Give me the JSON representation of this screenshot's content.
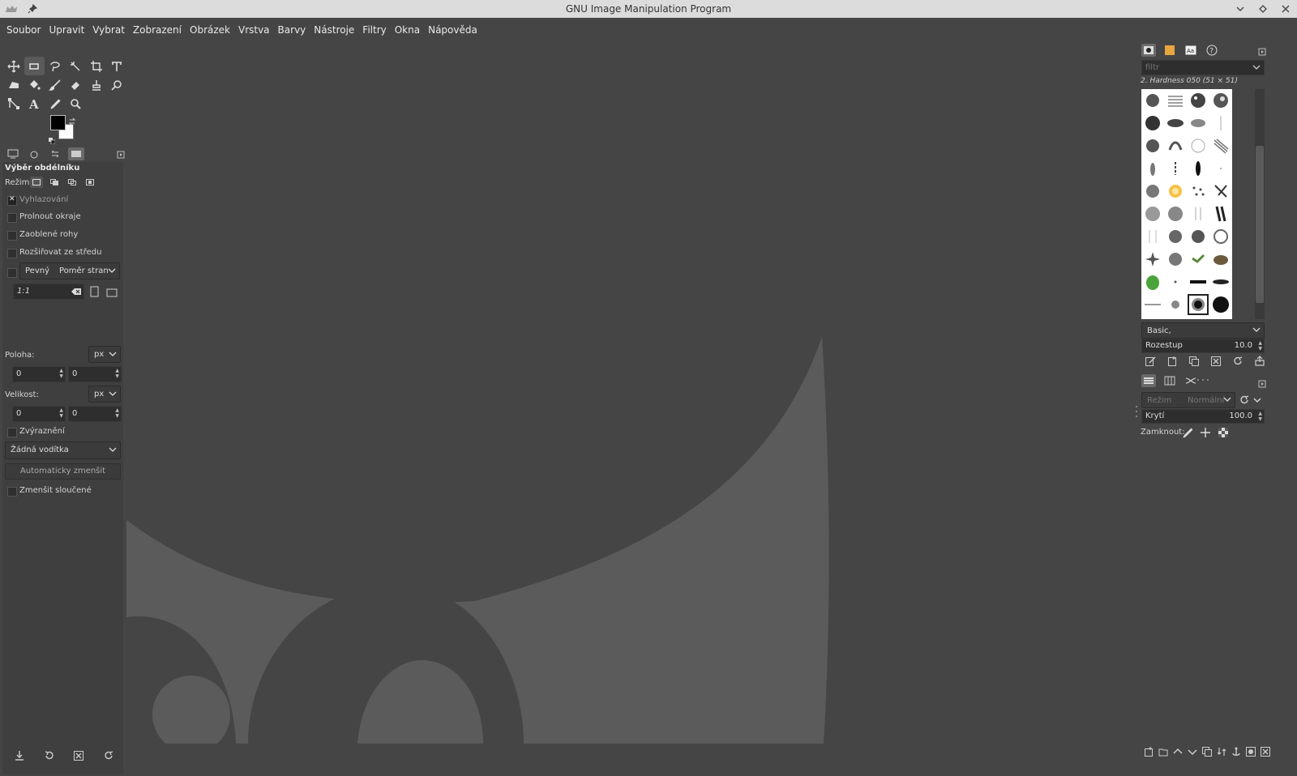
{
  "window": {
    "title": "GNU Image Manipulation Program"
  },
  "menu": [
    "Soubor",
    "Upravit",
    "Vybrat",
    "Zobrazení",
    "Obrázek",
    "Vrstva",
    "Barvy",
    "Nástroje",
    "Filtry",
    "Okna",
    "Nápověda"
  ],
  "tool_options": {
    "title": "Výběr obdélníku",
    "mode_label": "Režim:",
    "antialiasing": "Vyhlazování",
    "feather": "Prolnout okraje",
    "rounded": "Zaoblené rohy",
    "expand_center": "Rozšiřovat ze středu",
    "fixed_label": "Pevný",
    "fixed_option": "Poměr stran",
    "ratio_value": "1:1",
    "position_label": "Poloha:",
    "position_unit": "px",
    "position_x": "0",
    "position_y": "0",
    "size_label": "Velikost:",
    "size_unit": "px",
    "size_w": "0",
    "size_h": "0",
    "highlight": "Zvýraznění",
    "guides": "Žádná vodítka",
    "auto_shrink": "Automaticky zmenšit",
    "shrink_merged": "Zmenšit sloučené"
  },
  "brushes": {
    "filter_placeholder": "filtr",
    "current_brush": "2. Hardness 050 (51 × 51)",
    "tag": "Basic,",
    "spacing_label": "Rozestup",
    "spacing_value": "10.0"
  },
  "layers": {
    "mode_label": "Režim",
    "mode_value": "Normální",
    "opacity_label": "Krytí",
    "opacity_value": "100.0",
    "lock_label": "Zamknout:"
  }
}
